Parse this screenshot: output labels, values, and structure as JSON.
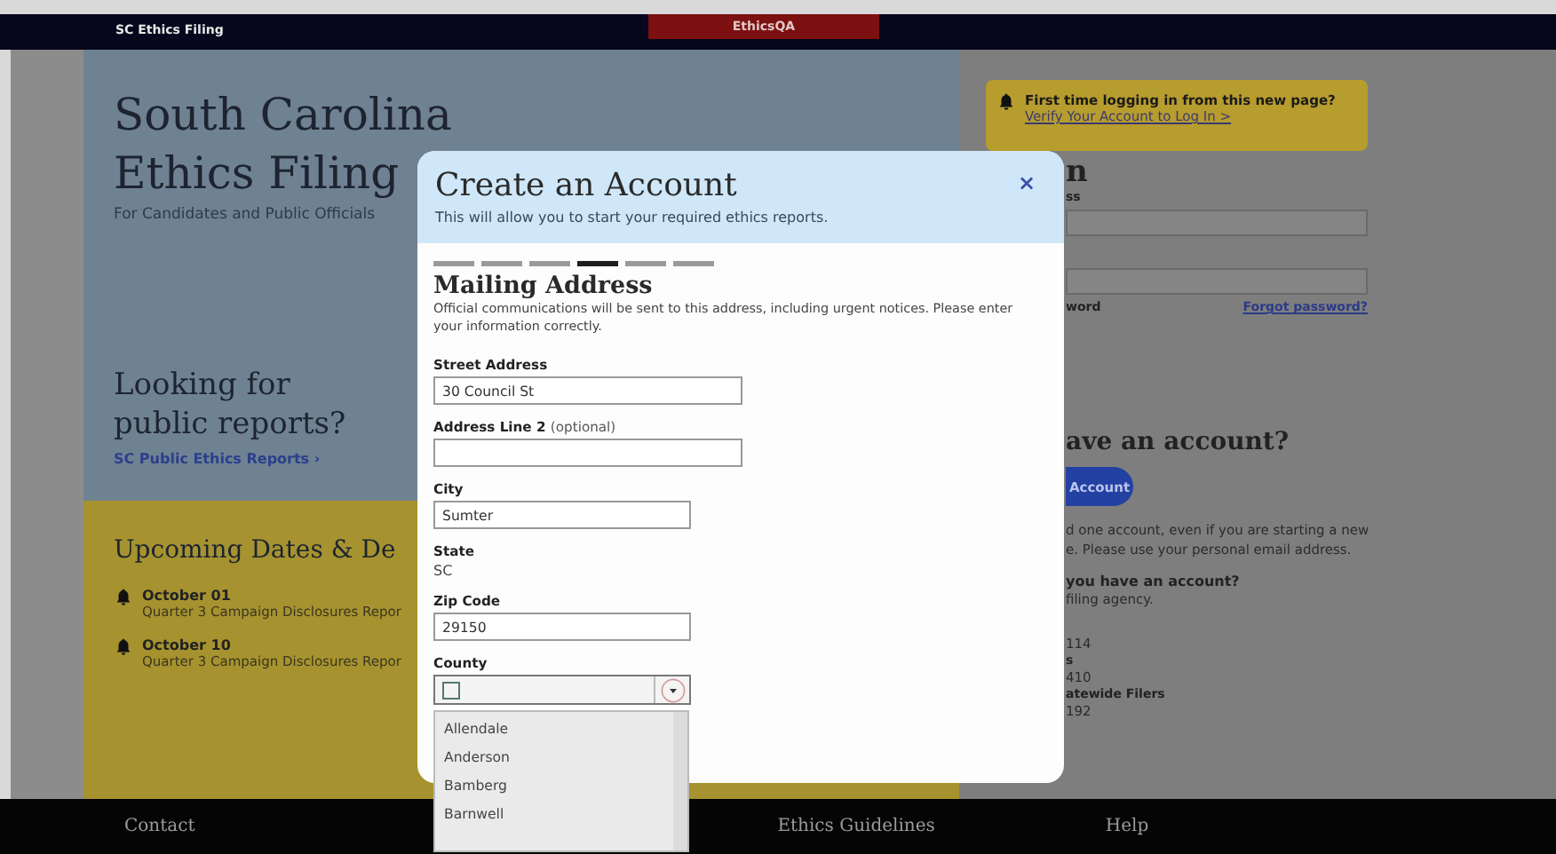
{
  "top_bar": {
    "site_name": "SC Ethics Filing",
    "environment_badge": "EthicsQA"
  },
  "hero": {
    "title_lines": [
      "South Carolina",
      "Ethics Filing"
    ],
    "subtitle": "For Candidates and Public Officials"
  },
  "public_reports": {
    "heading_lines": [
      "Looking for",
      "public reports?"
    ],
    "link": "SC Public Ethics Reports",
    "link_arrow": "›"
  },
  "upcoming": {
    "heading": "Upcoming Dates & De",
    "items": [
      {
        "date": "October 01",
        "description": "Quarter 3 Campaign Disclosures Repor"
      },
      {
        "date": "October 10",
        "description": "Quarter 3 Campaign Disclosures Repor"
      }
    ]
  },
  "login_notice": {
    "title": "First time logging in from this new page?",
    "link": "Verify Your Account to Log In >"
  },
  "login": {
    "heading": "n",
    "email_label": "ss",
    "password_hint": "word",
    "forgot_link": "Forgot password?"
  },
  "signup": {
    "heading": "ave an account?",
    "button": "Account",
    "note_lines": [
      "d one account, even if you are starting a new",
      "e. Please use your personal email address."
    ],
    "question": "you have an account?",
    "answer": "filing agency.",
    "contacts": [
      {
        "value": "114"
      },
      {
        "label": "s",
        "value": "410"
      },
      {
        "label": "atewide Filers",
        "value": "192"
      }
    ]
  },
  "footer": {
    "links": [
      "Contact",
      "Ethics Guidelines",
      "Help"
    ]
  },
  "modal": {
    "title": "Create an Account",
    "subtitle": "This will allow you to start your required ethics reports.",
    "close": "×",
    "steps": [
      {
        "selected": false
      },
      {
        "selected": false
      },
      {
        "selected": false
      },
      {
        "selected": true
      },
      {
        "selected": false
      },
      {
        "selected": false
      }
    ],
    "section_title": "Mailing Address",
    "section_note": "Official communications will be sent to this address, including urgent notices. Please enter your information correctly.",
    "fields": [
      {
        "kind": "input",
        "label": "Street Address",
        "value": "30 Council St"
      },
      {
        "kind": "input",
        "label": "Address Line 2",
        "label_note": "(optional)"
      },
      {
        "kind": "input",
        "label": "City",
        "value": "Sumter"
      },
      {
        "kind": "static",
        "label": "State",
        "value": "SC"
      },
      {
        "kind": "input",
        "label": "Zip Code",
        "value": "29150"
      },
      {
        "kind": "select",
        "label": "County",
        "expanded": true,
        "options": [
          "Allendale",
          "Anderson",
          "Bamberg",
          "Barnwell"
        ]
      }
    ]
  }
}
